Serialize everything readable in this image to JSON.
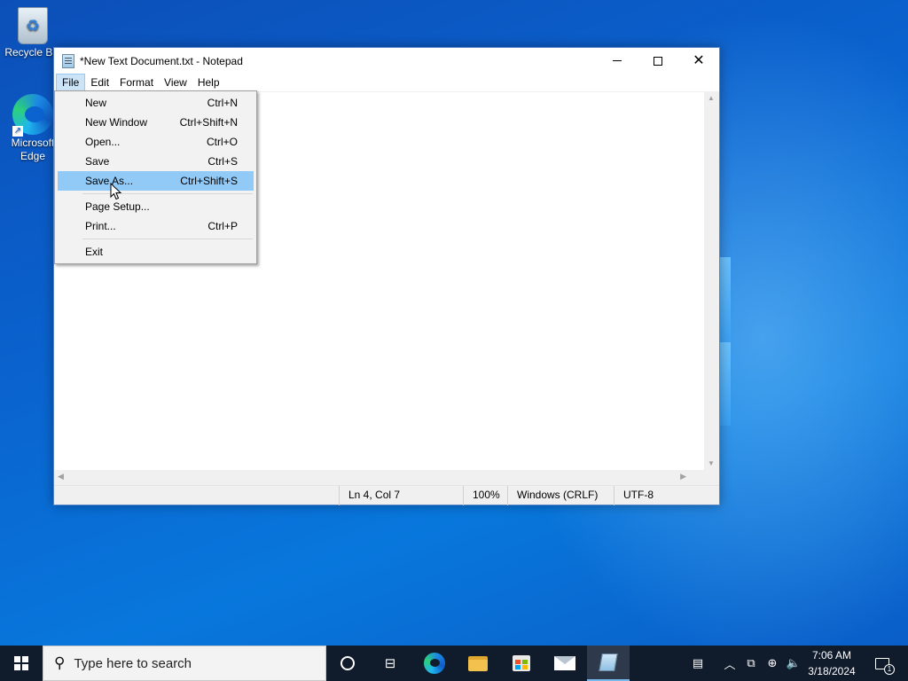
{
  "desktop": {
    "icons": [
      {
        "label": "Recycle Bin"
      },
      {
        "label": "Microsoft Edge"
      }
    ]
  },
  "window": {
    "title": "*New Text Document.txt - Notepad",
    "caption_min": "minimize",
    "caption_max": "maximize",
    "caption_close": "✕"
  },
  "menubar": {
    "items": [
      "File",
      "Edit",
      "Format",
      "View",
      "Help"
    ],
    "active": "File"
  },
  "file_menu": {
    "items": [
      {
        "label": "New",
        "shortcut": "Ctrl+N"
      },
      {
        "label": "New Window",
        "shortcut": "Ctrl+Shift+N"
      },
      {
        "label": "Open...",
        "shortcut": "Ctrl+O"
      },
      {
        "label": "Save",
        "shortcut": "Ctrl+S"
      },
      {
        "label": "Save As...",
        "shortcut": "Ctrl+Shift+S"
      },
      {
        "label": "Page Setup...",
        "shortcut": ""
      },
      {
        "label": "Print...",
        "shortcut": "Ctrl+P"
      },
      {
        "label": "Exit",
        "shortcut": ""
      }
    ],
    "highlighted": "Save As..."
  },
  "statusbar": {
    "position": "Ln 4, Col 7",
    "zoom": "100%",
    "line_ending": "Windows (CRLF)",
    "encoding": "UTF-8"
  },
  "taskbar": {
    "search_placeholder": "Type here to search",
    "time": "7:06 AM",
    "date": "3/18/2024",
    "notification_count": "1",
    "icons": [
      "cortana-icon",
      "task-view-icon",
      "edge-icon",
      "file-explorer-icon",
      "store-icon",
      "mail-icon",
      "notepad-icon"
    ]
  },
  "colors": {
    "menu_highlight": "#91c9f7",
    "taskbar": "#101b2b",
    "desktop": "#0a63cf"
  }
}
